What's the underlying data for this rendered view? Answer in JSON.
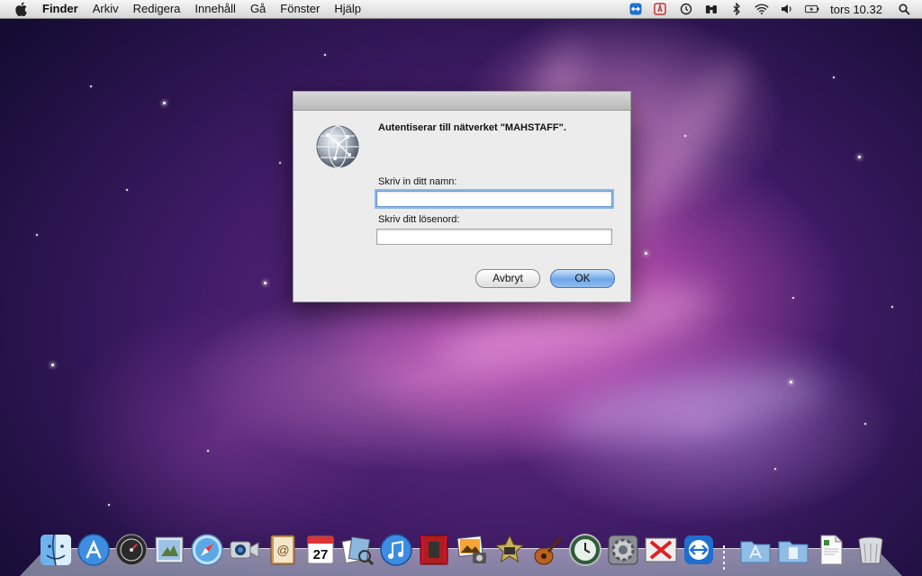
{
  "menubar": {
    "app_name": "Finder",
    "menus": [
      "Arkiv",
      "Redigera",
      "Innehåll",
      "Gå",
      "Fönster",
      "Hjälp"
    ],
    "status_icons": [
      "teamviewer-icon",
      "adobe-updater-icon",
      "time-machine-icon",
      "binoculars-icon",
      "bluetooth-icon",
      "wifi-icon",
      "volume-icon",
      "battery-icon"
    ],
    "clock": "tors 10.32",
    "spotlight_icon": "magnifier-icon"
  },
  "dialog": {
    "icon": "network-globe-icon",
    "message": "Autentiserar till nätverket \"MAHSTAFF\".",
    "name_label": "Skriv in ditt namn:",
    "name_value": "",
    "password_label": "Skriv ditt lösenord:",
    "password_value": "",
    "cancel_label": "Avbryt",
    "ok_label": "OK"
  },
  "dock": {
    "apps": [
      "finder-icon",
      "app-store-icon",
      "dashboard-icon",
      "mail-icon",
      "safari-icon",
      "facetime-icon",
      "address-book-icon",
      "ical-icon",
      "preview-icon",
      "itunes-icon",
      "photo-booth-icon",
      "iphoto-icon",
      "imovie-icon",
      "garageband-icon",
      "time-machine-icon",
      "system-preferences-icon",
      "x11-icon",
      "teamviewer-icon"
    ],
    "ical_date": "27",
    "stacks": [
      "applications-folder-icon",
      "documents-folder-icon",
      "pdf-document-icon",
      "trash-icon"
    ]
  },
  "colors": {
    "ok_button": "#6fa6e6",
    "focus_ring": "#8db7e8",
    "dialog_background": "#ececec"
  }
}
